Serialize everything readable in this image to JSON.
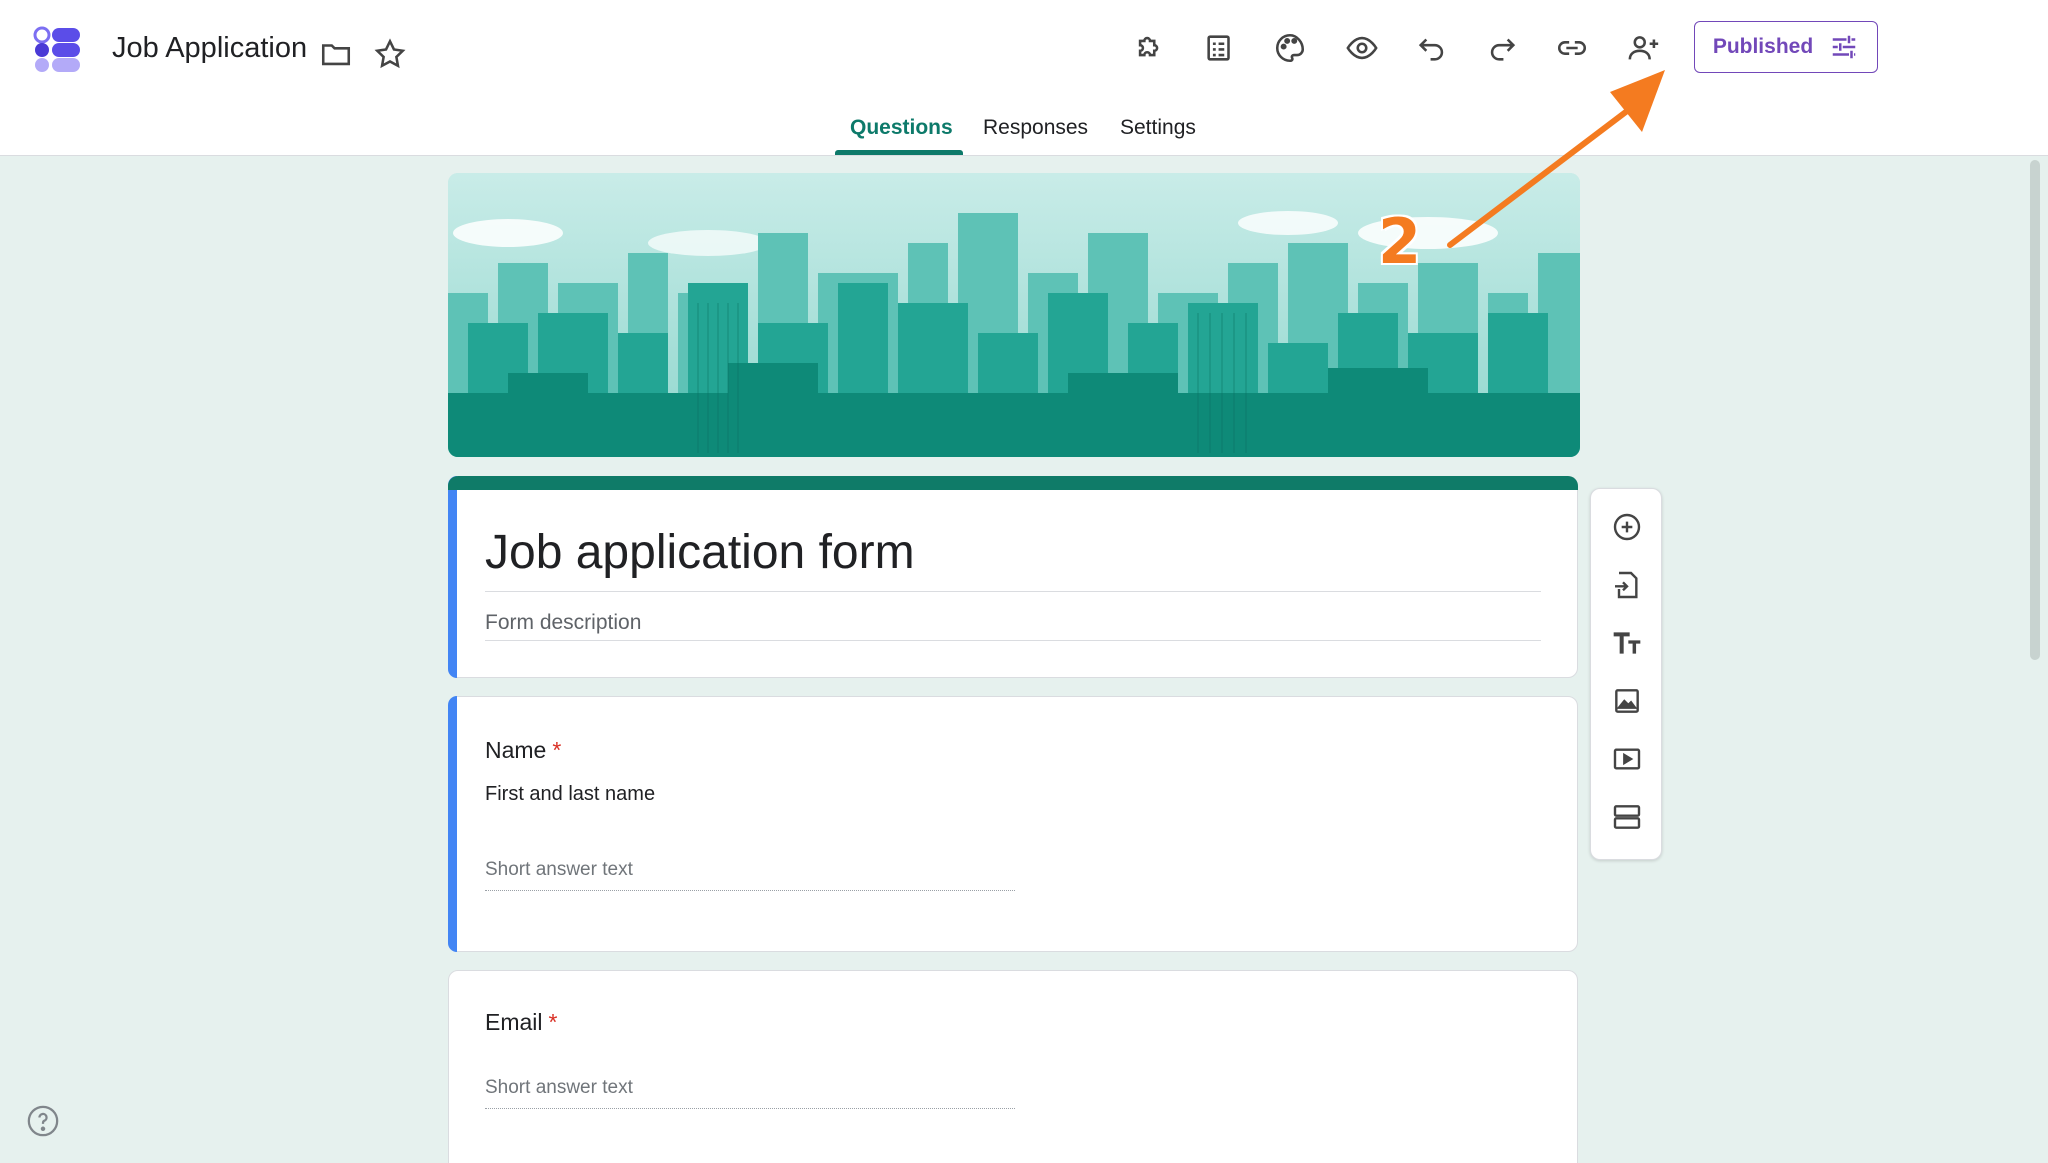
{
  "header": {
    "title": "Job Application",
    "folder_icon": "folder-icon",
    "star_icon": "star-icon",
    "toolbar_icons": [
      "addon-icon",
      "quiz-icon",
      "palette-icon",
      "preview-icon",
      "undo-icon",
      "redo-icon",
      "link-icon",
      "add-collaborator-icon"
    ],
    "publish_label": "Published",
    "accent_color": "#7248b9"
  },
  "tabs": [
    {
      "label": "Questions",
      "active": true
    },
    {
      "label": "Responses",
      "active": false
    },
    {
      "label": "Settings",
      "active": false
    }
  ],
  "form": {
    "title": "Job application form",
    "description_placeholder": "Form description",
    "theme_color": "#0f7b68"
  },
  "questions": [
    {
      "title": "Name",
      "required": true,
      "required_mark": "*",
      "description": "First and last name",
      "answer_placeholder": "Short answer text"
    },
    {
      "title": "Email",
      "required": true,
      "required_mark": "*",
      "answer_placeholder": "Short answer text"
    }
  ],
  "side_toolbar": [
    "add-question-icon",
    "import-questions-icon",
    "add-title-icon",
    "add-image-icon",
    "add-video-icon",
    "add-section-icon"
  ],
  "annotation": {
    "number": "2",
    "color": "#f47b20"
  }
}
